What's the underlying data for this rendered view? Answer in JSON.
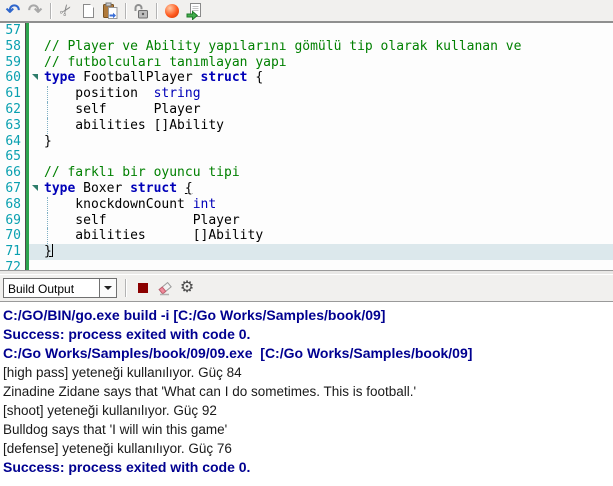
{
  "colors": {
    "keyword": "#0000b8",
    "comment": "#008000",
    "line_number": "#0aa0b0",
    "change_bar": "#2da44e",
    "fold_marker": "#2e7d6b",
    "current_line": "#dce8ec",
    "output_command": "#000090",
    "stop_button": "#8b0000",
    "red_ball": "#ff5a1f"
  },
  "toolbar": {
    "undo_glyph": "↶",
    "redo_glyph": "↷",
    "cut_glyph": "✂"
  },
  "editor": {
    "lines": [
      {
        "num": 57,
        "segs": []
      },
      {
        "num": 58,
        "segs": [
          [
            "comment",
            "// Player ve Ability yapılarını gömülü tip olarak kullanan ve"
          ]
        ]
      },
      {
        "num": 59,
        "segs": [
          [
            "comment",
            "// futbolcuları tanımlayan yapı"
          ]
        ]
      },
      {
        "num": 60,
        "fold": true,
        "segs": [
          [
            "keyword",
            "type"
          ],
          [
            "plain",
            " FootballPlayer "
          ],
          [
            "keyword",
            "struct"
          ],
          [
            "plain",
            " {"
          ]
        ]
      },
      {
        "num": 61,
        "guide": true,
        "segs": [
          [
            "plain",
            "    position  "
          ],
          [
            "type",
            "string"
          ]
        ]
      },
      {
        "num": 62,
        "guide": true,
        "segs": [
          [
            "plain",
            "    self      Player"
          ]
        ]
      },
      {
        "num": 63,
        "guide": true,
        "segs": [
          [
            "plain",
            "    abilities []Ability"
          ]
        ]
      },
      {
        "num": 64,
        "segs": [
          [
            "plain",
            "}"
          ]
        ]
      },
      {
        "num": 65,
        "segs": []
      },
      {
        "num": 66,
        "segs": [
          [
            "comment",
            "// farklı bir oyuncu tipi"
          ]
        ]
      },
      {
        "num": 67,
        "fold": true,
        "segs": [
          [
            "keyword",
            "type"
          ],
          [
            "plain",
            " Boxer "
          ],
          [
            "keyword",
            "struct"
          ],
          [
            "plain",
            " "
          ],
          [
            "brace",
            "{"
          ]
        ]
      },
      {
        "num": 68,
        "guide": true,
        "segs": [
          [
            "plain",
            "    knockdownCount "
          ],
          [
            "type",
            "int"
          ]
        ]
      },
      {
        "num": 69,
        "guide": true,
        "segs": [
          [
            "plain",
            "    self           Player"
          ]
        ]
      },
      {
        "num": 70,
        "guide": true,
        "segs": [
          [
            "plain",
            "    abilities      []Ability"
          ]
        ]
      },
      {
        "num": 71,
        "current": true,
        "caret": true,
        "segs": [
          [
            "brace",
            "}"
          ]
        ]
      },
      {
        "num": 72,
        "segs": []
      }
    ]
  },
  "output_panel": {
    "view_selector": "Build Output",
    "gear_glyph": "⚙",
    "lines": [
      {
        "style": "command",
        "text": "C:/GO/BIN/go.exe build -i [C:/Go Works/Samples/book/09]"
      },
      {
        "style": "command",
        "text": "Success: process exited with code 0."
      },
      {
        "style": "command",
        "text": "C:/Go Works/Samples/book/09/09.exe  [C:/Go Works/Samples/book/09]"
      },
      {
        "style": "plain",
        "text": "[high pass] yeteneği kullanılıyor. Güç 84"
      },
      {
        "style": "plain",
        "text": "Zinadine Zidane says that 'What can I do sometimes. This is football.'"
      },
      {
        "style": "plain",
        "text": "[shoot] yeteneği kullanılıyor. Güç 92"
      },
      {
        "style": "plain",
        "text": "Bulldog says that 'I will win this game'"
      },
      {
        "style": "plain",
        "text": "[defense] yeteneği kullanılıyor. Güç 76"
      },
      {
        "style": "command",
        "text": "Success: process exited with code 0."
      }
    ]
  }
}
